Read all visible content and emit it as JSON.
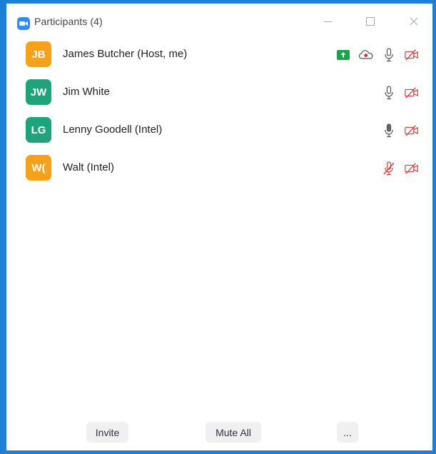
{
  "window": {
    "title": "Participants (4)",
    "accent_color": "#1e7fd6",
    "app_icon": "zoom-camera-icon"
  },
  "participants": [
    {
      "initials": "JB",
      "name": "James Butcher (Host, me)",
      "avatar_color": "#f7a11a",
      "icons": [
        "share-screen-icon",
        "cloud-record-icon",
        "microphone-icon",
        "video-off-icon"
      ]
    },
    {
      "initials": "JW",
      "name": "Jim White",
      "avatar_color": "#1fa37a",
      "icons": [
        "microphone-icon",
        "video-off-icon"
      ]
    },
    {
      "initials": "LG",
      "name": "Lenny Goodell (Intel)",
      "avatar_color": "#1fa37a",
      "icons": [
        "microphone-active-icon",
        "video-off-icon"
      ]
    },
    {
      "initials": "W(",
      "name": "Walt (Intel)",
      "avatar_color": "#f7a11a",
      "icons": [
        "microphone-muted-icon",
        "video-off-icon"
      ]
    }
  ],
  "footer": {
    "invite_label": "Invite",
    "mute_all_label": "Mute All",
    "more_label": "..."
  }
}
